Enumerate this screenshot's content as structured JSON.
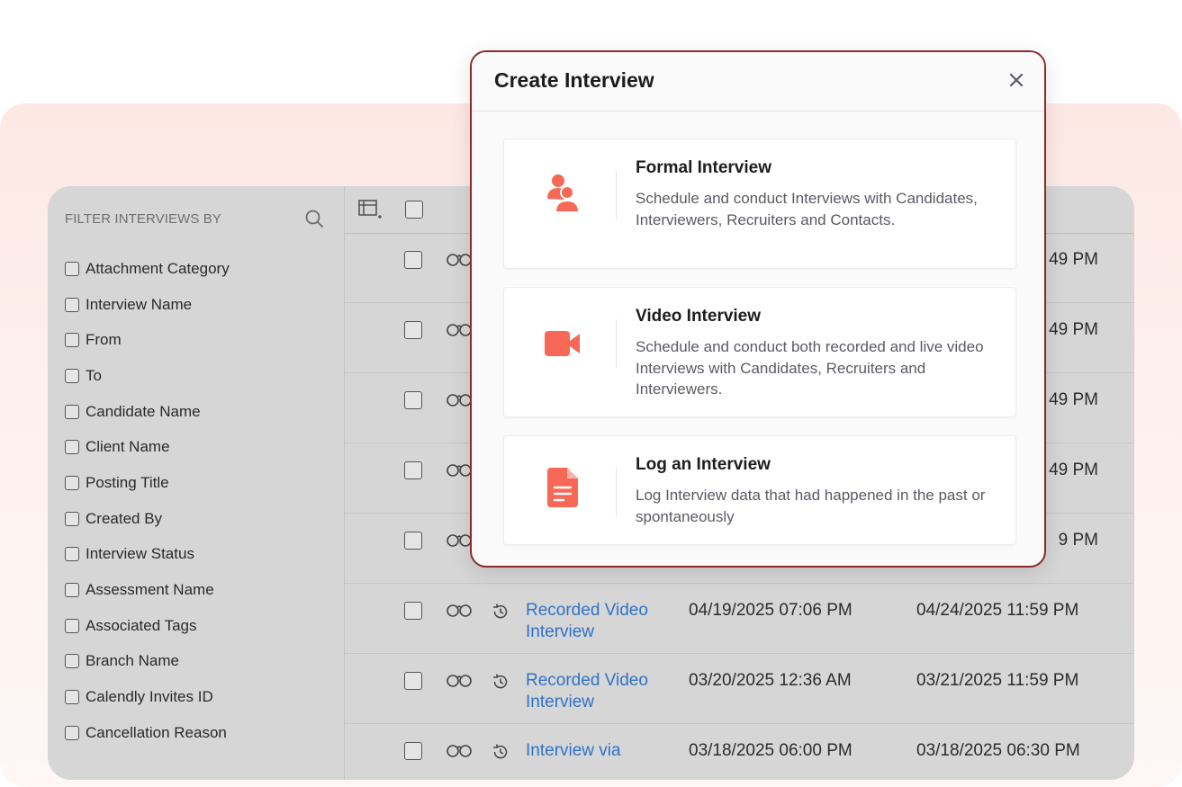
{
  "filter": {
    "title": "FILTER INTERVIEWS BY",
    "items": [
      "Attachment Category",
      "Interview Name",
      "From",
      "To",
      "Candidate Name",
      "Client Name",
      "Posting Title",
      "Created By",
      "Interview Status",
      "Assessment Name",
      "Associated Tags",
      "Branch Name",
      "Calendly Invites ID",
      "Cancellation Reason"
    ]
  },
  "table": {
    "rows": [
      {
        "type": "",
        "from": "",
        "to": "49 PM"
      },
      {
        "type": "",
        "from": "",
        "to": "49 PM"
      },
      {
        "type": "",
        "from": "",
        "to": "49 PM"
      },
      {
        "type": "",
        "from": "",
        "to": "49 PM"
      },
      {
        "type": "",
        "from": "",
        "to": "9 PM"
      },
      {
        "type": "Recorded Video Interview",
        "from": "04/19/2025 07:06 PM",
        "to": "04/24/2025 11:59 PM"
      },
      {
        "type": "Recorded Video Interview",
        "from": "03/20/2025 12:36 AM",
        "to": "03/21/2025 11:59 PM"
      },
      {
        "type": "Interview via",
        "from": "03/18/2025 06:00 PM",
        "to": "03/18/2025 06:30 PM"
      }
    ]
  },
  "modal": {
    "title": "Create Interview",
    "options": [
      {
        "title": "Formal Interview",
        "description": "Schedule and conduct Interviews with Candidates, Interviewers, Recruiters and Contacts.",
        "icon": "people-icon"
      },
      {
        "title": "Video Interview",
        "description": "Schedule and conduct both recorded and live video Interviews with Candidates, Recruiters and Interviewers.",
        "icon": "video-camera-icon"
      },
      {
        "title": "Log an Interview",
        "description": "Log Interview data that had happened in the past or spontaneously",
        "icon": "document-icon"
      }
    ]
  },
  "colors": {
    "accent": "#f76856",
    "link": "#2f73c7",
    "modal_border": "#8c2a2a"
  }
}
